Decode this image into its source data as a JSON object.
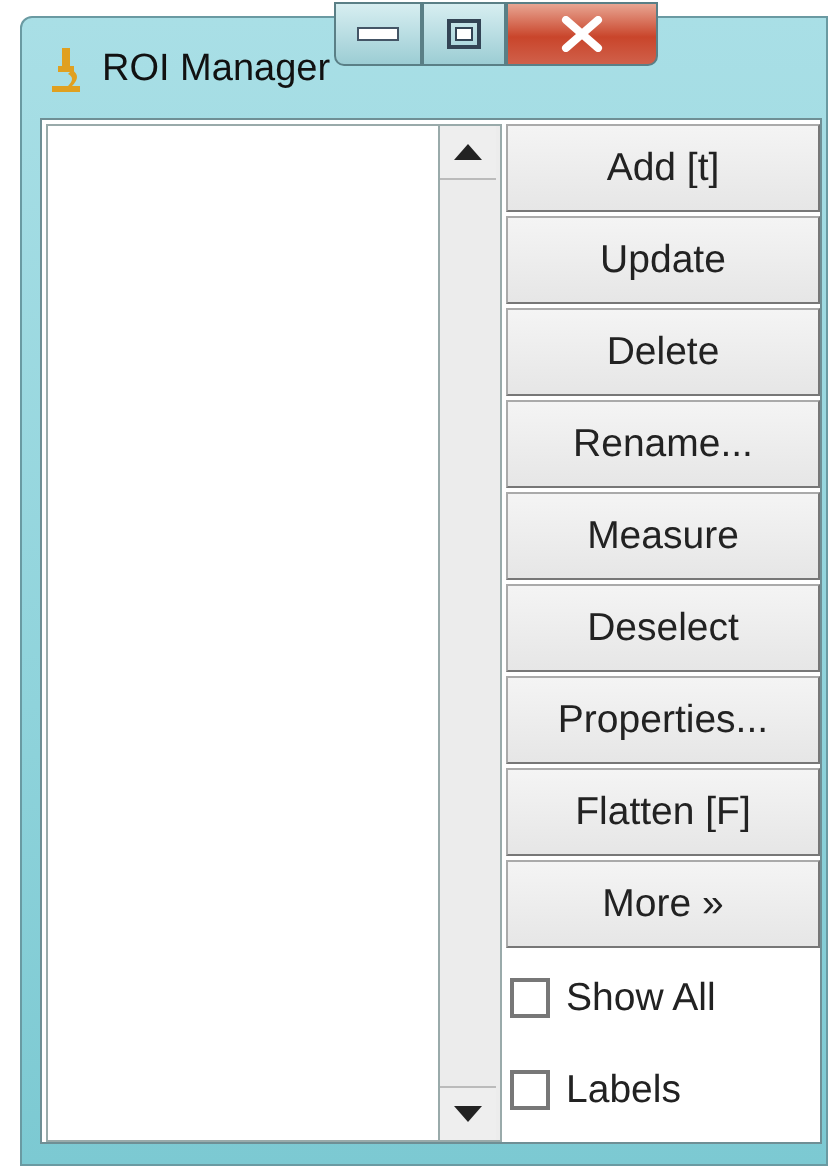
{
  "window": {
    "title": "ROI Manager"
  },
  "buttons": [
    {
      "label": "Add [t]"
    },
    {
      "label": "Update"
    },
    {
      "label": "Delete"
    },
    {
      "label": "Rename..."
    },
    {
      "label": "Measure"
    },
    {
      "label": "Deselect"
    },
    {
      "label": "Properties..."
    },
    {
      "label": "Flatten [F]"
    },
    {
      "label": "More »"
    }
  ],
  "checkboxes": [
    {
      "label": "Show All",
      "checked": false
    },
    {
      "label": "Labels",
      "checked": false
    }
  ]
}
